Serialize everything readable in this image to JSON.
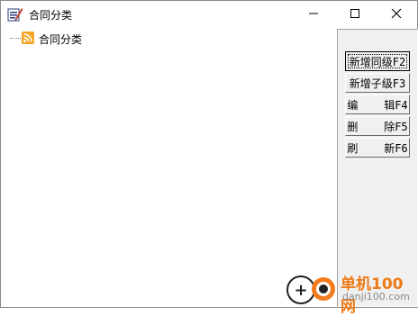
{
  "window": {
    "title": "合同分类",
    "icon": "app-edit-icon",
    "controls": {
      "minimize": "minimize-icon",
      "maximize": "maximize-icon",
      "close": "close-icon"
    }
  },
  "tree": {
    "root": {
      "label": "合同分类",
      "icon": "rss-icon",
      "icon_color": "#f5a623"
    }
  },
  "panel": {
    "buttons": [
      {
        "label": "新增同级F2",
        "default": true
      },
      {
        "label": "新增子级F3"
      },
      {
        "label": "编    辑F4"
      },
      {
        "label": "删    除F5"
      },
      {
        "label": "刷    新F6"
      }
    ]
  },
  "watermark": {
    "title": "单机100网",
    "url": "danji100.com",
    "accent": "#f37b1d"
  }
}
